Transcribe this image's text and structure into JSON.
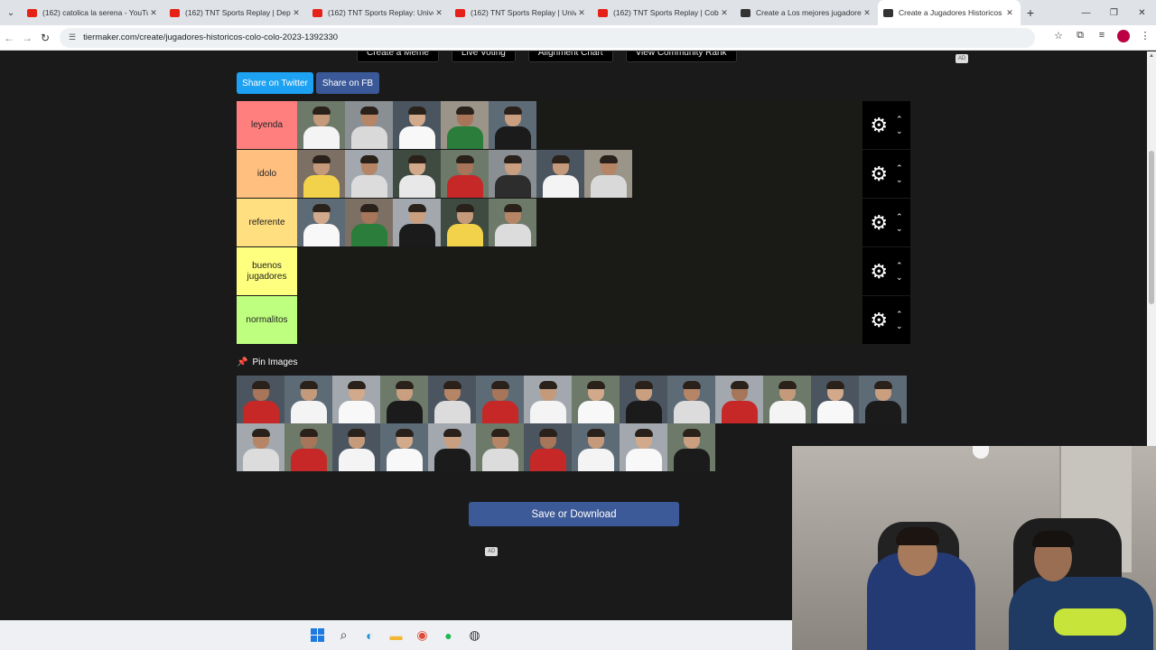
{
  "browser": {
    "tabs": [
      {
        "label": "(162) catolica la serena - YouTub",
        "favicon": "youtube",
        "active": false
      },
      {
        "label": "(162) TNT Sports Replay | Depo",
        "favicon": "youtube",
        "active": false
      },
      {
        "label": "(162) TNT Sports Replay: Unive",
        "favicon": "youtube",
        "active": false
      },
      {
        "label": "(162) TNT Sports Replay | Unive",
        "favicon": "youtube",
        "active": false
      },
      {
        "label": "(162) TNT Sports Replay | Cobr",
        "favicon": "youtube",
        "active": false
      },
      {
        "label": "Create a Los mejores jugadores",
        "favicon": "tiermaker",
        "active": false
      },
      {
        "label": "Create a Jugadores Historicos",
        "favicon": "tiermaker",
        "active": true
      }
    ],
    "url": "tiermaker.com/create/jugadores-historicos-colo-colo-2023-1392330"
  },
  "page": {
    "top_buttons": [
      "Create a Meme",
      "Live Voting",
      "Alignment Chart",
      "View Community Rank"
    ],
    "ad_label": "AD",
    "share_twitter": "Share on Twitter",
    "share_fb": "Share on FB",
    "tiers": [
      {
        "label": "leyenda",
        "color": "#ff7f7f",
        "count": 5
      },
      {
        "label": "idolo",
        "color": "#ffbf7f",
        "count": 7
      },
      {
        "label": "referente",
        "color": "#ffdf7f",
        "count": 5
      },
      {
        "label": "buenos jugadores",
        "color": "#ffff7f",
        "count": 0
      },
      {
        "label": "normalitos",
        "color": "#bfff7f",
        "count": 0
      }
    ],
    "pin_images_label": "Pin Images",
    "pool_count": 24,
    "save_button": "Save or Download"
  },
  "taskbar": {
    "icons": [
      "windows-start",
      "search",
      "edge",
      "file-explorer",
      "chrome",
      "spotify",
      "recorder"
    ]
  },
  "colors": {
    "twitter": "#1da1f2",
    "facebook": "#3b5998",
    "save": "#3d5a98"
  }
}
